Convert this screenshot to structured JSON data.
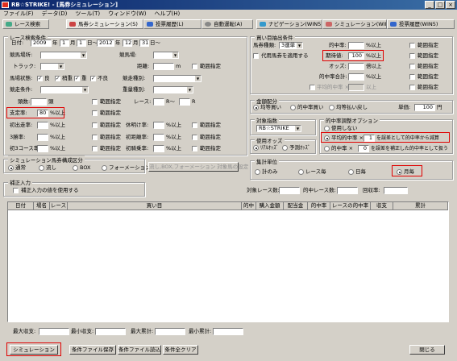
{
  "window": {
    "title": "RB☆STRIKE! - [馬券シミュレーション]",
    "min": "_",
    "max": "□",
    "close": "×"
  },
  "menu": [
    "ファイル(F)",
    "データ(D)",
    "ツール(T)",
    "ウィンドウ(W)",
    "ヘルプ(H)"
  ],
  "tabs": [
    "レース検索",
    "馬券シミュレーション(S)",
    "投票履歴(L)",
    "自動運転(A)",
    "ナビゲーション(WIN5)",
    "シミュレーション(WIN5)",
    "投票履歴(WIN5)"
  ],
  "race_search": {
    "legend": "レース検索条件",
    "date_label": "日付:",
    "from_year": "2009",
    "year_suffix": "年",
    "from_month": "1",
    "month_suffix": "月",
    "from_day": "1",
    "day_suffix": "日～",
    "to_year": "2012",
    "to_month": "12",
    "to_day": "31",
    "venue_label": "競馬場所:",
    "distance_type_label": "競馬場:",
    "track_label": "トラック:",
    "distance_label": "距離:",
    "distance_unit": "m",
    "range_label": "範囲指定",
    "condition_label": "馬場状態:",
    "conditions": [
      "良",
      "稍重",
      "重",
      "不良"
    ],
    "race_type_label": "競走種別:",
    "race_condition_label": "競走条件:",
    "weight_label": "重量種別:",
    "horses_label": "頭数:",
    "horses_unit": "頭",
    "race_label": "レース:",
    "race_r1": "R～",
    "race_r2": "R",
    "odds_label": "支定率:",
    "odds_value": "80",
    "odds_unit": "%以上",
    "c1": "初出走率:",
    "c2": "3勝率:",
    "c3": "初3コース率:",
    "c4": "休明け率:",
    "c5": "初距離率:",
    "c6": "初騎乗率:",
    "pct_unit": "%以上"
  },
  "ticket": {
    "legend": "買い目抽出条件",
    "type_label": "馬券種類:",
    "type_value": "3連単",
    "substitute_label": "代用馬券を適用する",
    "hit_label": "的中率:",
    "hit_unit": "%以上",
    "recovery_label": "期待値:",
    "recovery_value": "100",
    "recovery_unit": "%以上",
    "odds_label": "オッズ:",
    "odds_unit": "倍以上",
    "hit_total_label": "的中率合計:",
    "hit_total_unit": "%以上",
    "avg_hit_label": "平均的中率 ×",
    "avg_hit_unit": "以上",
    "range_label": "範囲指定"
  },
  "bet": {
    "legend": "金額配分",
    "options": [
      "均等買い",
      "的中率買い",
      "均等払い戻し"
    ],
    "unit_label": "単価:",
    "unit_value": "100",
    "unit_suffix": "円"
  },
  "target": {
    "legend": "対象指数",
    "value": "RB☆STRIKE"
  },
  "odds_use": {
    "legend": "使用オッズ",
    "options": [
      "ﾘｱﾙｵｯｽﾞ",
      "予測ｵｯｽﾞ"
    ]
  },
  "adjust": {
    "legend": "的中率調整オプション",
    "none": "使用しない",
    "opt1_a": "平均的中率 ×",
    "opt1_val": "1",
    "opt1_b": "を誤差として的中率から減算",
    "opt2_a": "的中率 ×",
    "opt2_val": "0",
    "opt2_b": "を誤差を補正した的中率として扱う"
  },
  "combo": {
    "legend": "シミュレーション馬券構成区分",
    "options": [
      "通常",
      "流し",
      "BOX",
      "フォーメーション"
    ],
    "button": "流し,BOX,フォーメーション 対象馬の設定"
  },
  "correction": {
    "legend": "補正入力",
    "label": "補正入力の値を使用する"
  },
  "agg": {
    "legend": "集計単位",
    "options": [
      "計のみ",
      "レース毎",
      "日毎",
      "月毎"
    ],
    "target_races_label": "対象レース数:",
    "hit_races_label": "的中レース数:",
    "recovery_rate_label": "回収率:"
  },
  "grid_headers": [
    "日付",
    "場名",
    "レース",
    "買い目",
    "的中",
    "購入金額",
    "配当金",
    "的中率",
    "レースの的中率",
    "収支",
    "累計"
  ],
  "summary": {
    "max_loss": "最大収支:",
    "min_loss": "最小収支:",
    "max_total": "最大累計:",
    "min_total": "最小累計:"
  },
  "buttons": {
    "simulate": "シミュレーション",
    "save": "条件ファイル保存",
    "load": "条件ファイル読込",
    "clear": "条件全クリア",
    "close": "閉じる"
  }
}
